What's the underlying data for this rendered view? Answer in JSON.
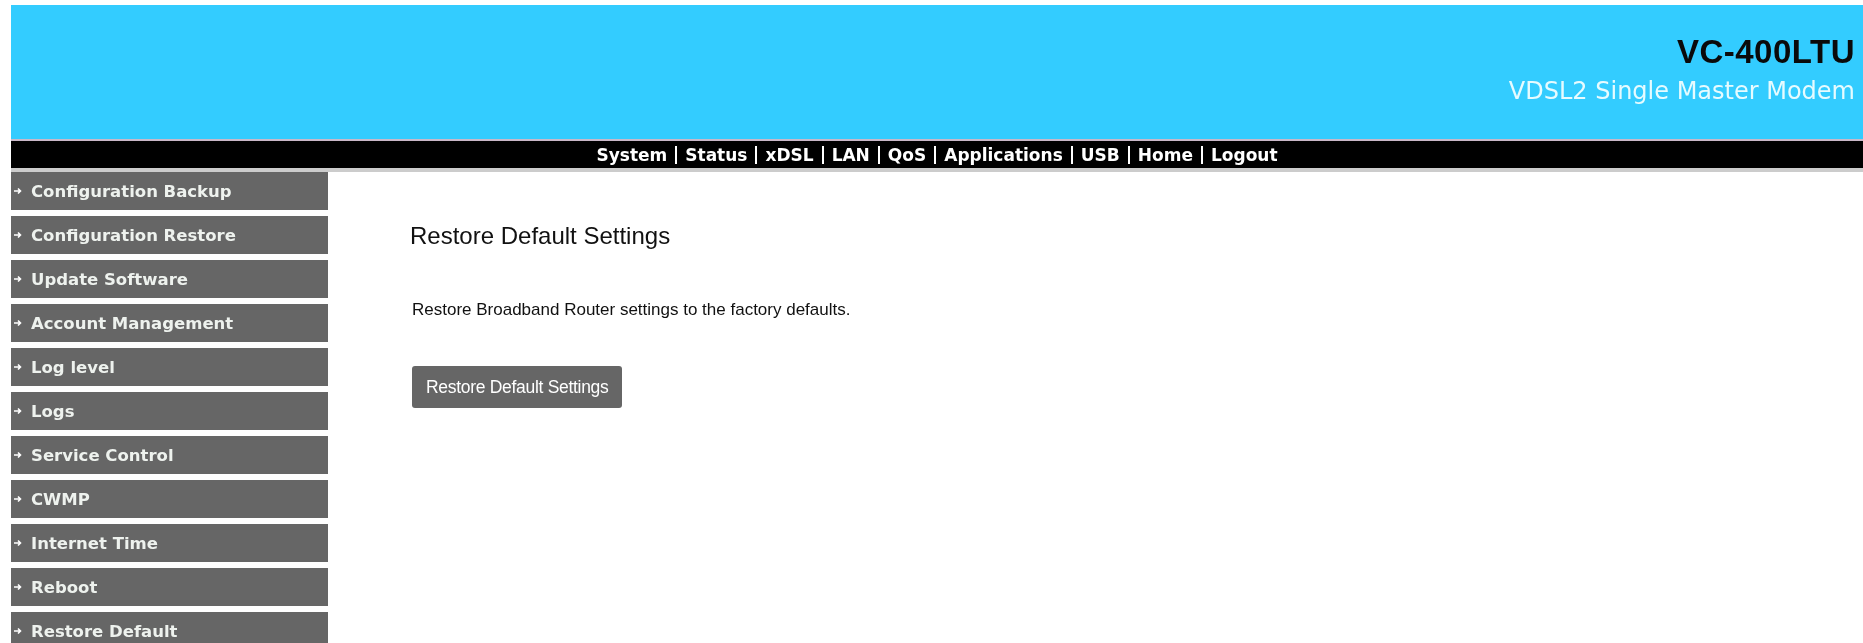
{
  "header": {
    "model": "VC-400LTU",
    "product": "VDSL2 Single Master Modem"
  },
  "nav": [
    "System",
    "Status",
    "xDSL",
    "LAN",
    "QoS",
    "Applications",
    "USB",
    "Home",
    "Logout"
  ],
  "sidebar": {
    "items": [
      "Configuration Backup",
      "Configuration Restore",
      "Update Software",
      "Account Management",
      "Log level",
      "Logs",
      "Service Control",
      "CWMP",
      "Internet Time",
      "Reboot",
      "Restore Default"
    ]
  },
  "content": {
    "title": "Restore Default Settings",
    "description": "Restore Broadband Router settings to the factory defaults.",
    "button": "Restore Default Settings"
  }
}
